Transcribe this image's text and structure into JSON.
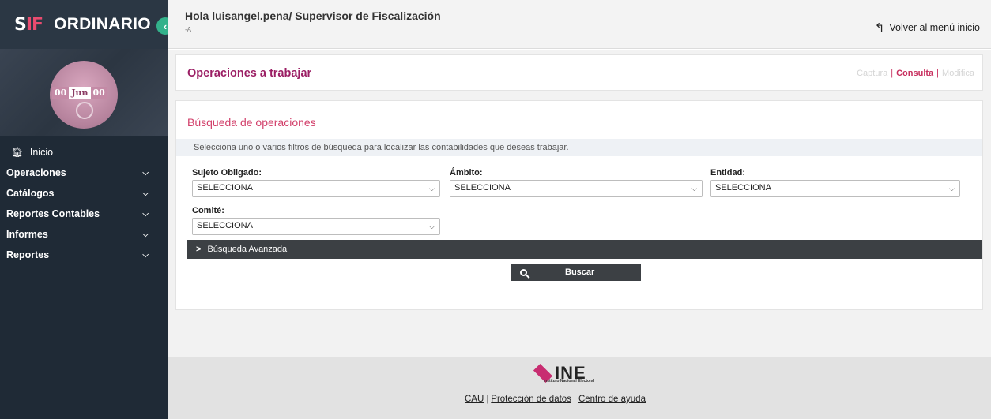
{
  "brand": {
    "logo_s": "S",
    "logo_if": "IF",
    "title": "ORDINARIO",
    "collapse_icon": "‹"
  },
  "profile": {
    "date_day": "00",
    "date_month": "Jun",
    "date_year": "00"
  },
  "nav": {
    "home": "Inicio",
    "items": [
      {
        "label": "Operaciones"
      },
      {
        "label": "Catálogos"
      },
      {
        "label": "Reportes Contables"
      },
      {
        "label": "Informes"
      },
      {
        "label": "Reportes"
      }
    ]
  },
  "header": {
    "greeting": "Hola luisangel.pena/ Supervisor de Fiscalización",
    "sub": "-A",
    "back_label": "Volver al menú inicio"
  },
  "operaciones": {
    "title": "Operaciones a trabajar",
    "modes": [
      "Captura",
      "Consulta",
      "Modifica"
    ],
    "active_mode": "Consulta"
  },
  "busqueda": {
    "title": "Búsqueda de operaciones",
    "hint": "Selecciona uno o varios filtros de búsqueda para localizar las contabilidades que deseas trabajar.",
    "fields": [
      {
        "label": "Sujeto Obligado",
        "value": "SELECCIONA"
      },
      {
        "label": "Ámbito",
        "value": "SELECCIONA"
      },
      {
        "label": "Entidad",
        "value": "SELECCIONA"
      },
      {
        "label": "Comité",
        "value": "SELECCIONA"
      }
    ],
    "advanced_label": "Búsqueda Avanzada",
    "search_label": "Buscar"
  },
  "footer": {
    "logo_text": "INE",
    "logo_sub": "Instituto Nacional Electoral",
    "links": [
      "CAU",
      "Protección de datos",
      "Centro de ayuda"
    ]
  },
  "colors": {
    "sidebar": "#1f2a36",
    "accent": "#9b1e64",
    "section_title": "#d23f6a",
    "toggle": "#33b28b"
  }
}
